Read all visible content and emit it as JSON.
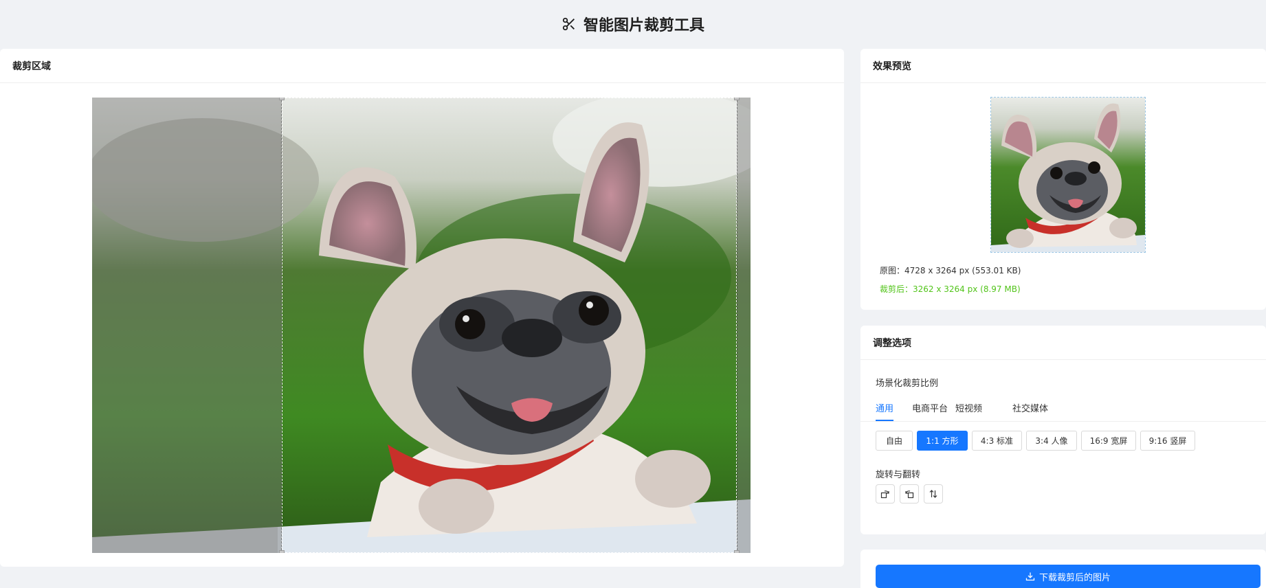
{
  "app": {
    "title": "智能图片裁剪工具",
    "icon": "scissors-icon"
  },
  "crop_panel": {
    "title": "裁剪区域"
  },
  "preview_panel": {
    "title": "效果预览",
    "original_info": "原图：4728 x 3264 px (553.01 KB)",
    "cropped_info": "裁剪后：3262 x 3264 px (8.97 MB)"
  },
  "options_panel": {
    "title": "调整选项",
    "ratio_section_label": "场景化裁剪比例",
    "tabs": [
      {
        "label": "通用",
        "active": true
      },
      {
        "label": "电商平台",
        "active": false
      },
      {
        "label": "短视频",
        "active": false
      },
      {
        "label": "社交媒体",
        "active": false
      }
    ],
    "ratios": [
      {
        "label": "自由",
        "active": false
      },
      {
        "label": "1:1 方形",
        "active": true
      },
      {
        "label": "4:3 标准",
        "active": false
      },
      {
        "label": "3:4 人像",
        "active": false
      },
      {
        "label": "16:9 宽屏",
        "active": false
      },
      {
        "label": "9:16 竖屏",
        "active": false
      }
    ],
    "rotate_section_label": "旋转与翻转",
    "rotate_tools": [
      "rotate-left-icon",
      "rotate-right-icon",
      "flip-vertical-icon"
    ]
  },
  "download": {
    "label": "下载裁剪后的图片",
    "icon": "download-icon"
  },
  "colors": {
    "accent": "#1677ff",
    "success": "#52c41a",
    "background": "#f0f2f5"
  }
}
